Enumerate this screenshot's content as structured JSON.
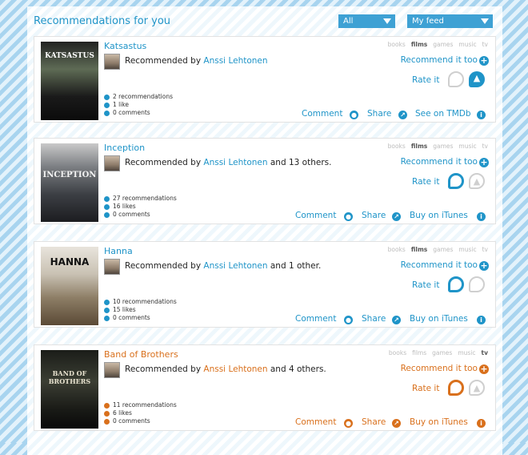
{
  "header": {
    "title": "Recommendations for you",
    "filter_category": "All",
    "filter_feed": "My feed"
  },
  "categories": [
    "books",
    "films",
    "games",
    "music",
    "tv"
  ],
  "labels": {
    "recommend": "Recommend it too",
    "rate": "Rate it",
    "comment": "Comment",
    "share": "Share"
  },
  "colors": {
    "accent": "#1f94c8",
    "highlight": "#d9701c"
  },
  "cards": [
    {
      "title": "Katsastus",
      "poster_text": "KATSASTUS",
      "recommender": "Anssi Lehtonen",
      "others": "",
      "active_category": "films",
      "recommendations": "2 recommendations",
      "likes": "1 like",
      "comments": "0 comments",
      "link": "See on TMDb"
    },
    {
      "title": "Inception",
      "poster_text": "INCEPTION",
      "recommender": "Anssi Lehtonen",
      "others": "and 13 others.",
      "active_category": "films",
      "recommendations": "27 recommendations",
      "likes": "16 likes",
      "comments": "0 comments",
      "link": "Buy on iTunes"
    },
    {
      "title": "Hanna",
      "poster_text": "HANNA",
      "recommender": "Anssi Lehtonen",
      "others": "and 1 other.",
      "active_category": "films",
      "recommendations": "10 recommendations",
      "likes": "15 likes",
      "comments": "0 comments",
      "link": "Buy on iTunes"
    },
    {
      "title": "Band of Brothers",
      "poster_text": "BAND OF BROTHERS",
      "recommender": "Anssi Lehtonen",
      "others": "and 4 others.",
      "active_category": "tv",
      "recommendations": "11 recommendations",
      "likes": "6 likes",
      "comments": "0 comments",
      "link": "Buy on iTunes"
    }
  ]
}
